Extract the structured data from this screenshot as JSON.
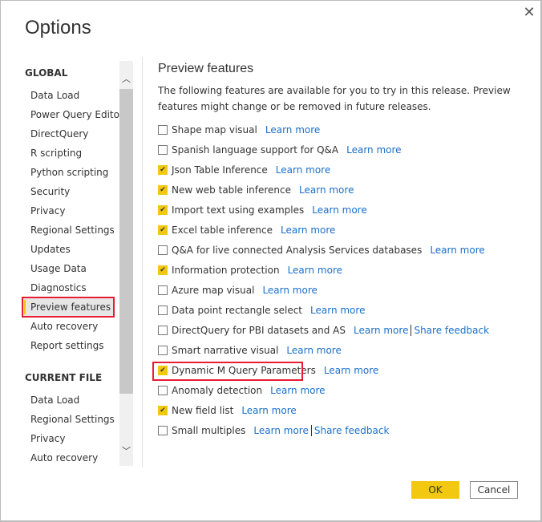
{
  "dialog": {
    "title": "Options",
    "close_icon": "close-icon"
  },
  "sidebar": {
    "global_label": "GLOBAL",
    "global_items": [
      "Data Load",
      "Power Query Editor",
      "DirectQuery",
      "R scripting",
      "Python scripting",
      "Security",
      "Privacy",
      "Regional Settings",
      "Updates",
      "Usage Data",
      "Diagnostics",
      "Preview features",
      "Auto recovery",
      "Report settings"
    ],
    "selected": "Preview features",
    "current_label": "CURRENT FILE",
    "current_items": [
      "Data Load",
      "Regional Settings",
      "Privacy",
      "Auto recovery"
    ]
  },
  "main": {
    "heading": "Preview features",
    "description": "The following features are available for you to try in this release. Preview features might change or be removed in future releases.",
    "features": [
      {
        "label": "Shape map visual",
        "checked": false,
        "learn_more": "Learn more"
      },
      {
        "label": "Spanish language support for Q&A",
        "checked": false,
        "learn_more": "Learn more"
      },
      {
        "label": "Json Table Inference",
        "checked": true,
        "learn_more": "Learn more"
      },
      {
        "label": "New web table inference",
        "checked": true,
        "learn_more": "Learn more"
      },
      {
        "label": "Import text using examples",
        "checked": true,
        "learn_more": "Learn more"
      },
      {
        "label": "Excel table inference",
        "checked": true,
        "learn_more": "Learn more"
      },
      {
        "label": "Q&A for live connected Analysis Services databases",
        "checked": false,
        "learn_more": "Learn more"
      },
      {
        "label": "Information protection",
        "checked": true,
        "learn_more": "Learn more"
      },
      {
        "label": "Azure map visual",
        "checked": false,
        "learn_more": "Learn more"
      },
      {
        "label": "Data point rectangle select",
        "checked": false,
        "learn_more": "Learn more"
      },
      {
        "label": "DirectQuery for PBI datasets and AS",
        "checked": false,
        "learn_more": "Learn more",
        "feedback": "Share feedback"
      },
      {
        "label": "Smart narrative visual",
        "checked": false,
        "learn_more": "Learn more"
      },
      {
        "label": "Dynamic M Query Parameters",
        "checked": true,
        "learn_more": "Learn more",
        "highlighted": true
      },
      {
        "label": "Anomaly detection",
        "checked": false,
        "learn_more": "Learn more"
      },
      {
        "label": "New field list",
        "checked": true,
        "learn_more": "Learn more"
      },
      {
        "label": "Small multiples",
        "checked": false,
        "learn_more": "Learn more",
        "feedback": "Share feedback"
      }
    ]
  },
  "footer": {
    "ok": "OK",
    "cancel": "Cancel"
  },
  "colors": {
    "accent": "#f2c811",
    "highlight": "#e81c33",
    "link": "#1a6fc9"
  }
}
